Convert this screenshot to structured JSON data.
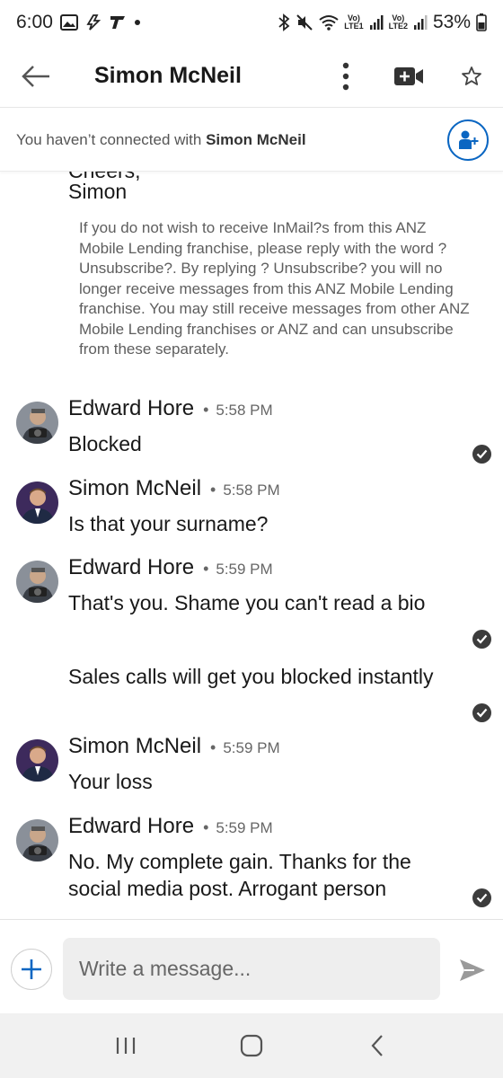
{
  "status_bar": {
    "time": "6:00",
    "lte1": "LTE1",
    "lte2": "LTE2",
    "volte": "Vo)",
    "battery": "53%"
  },
  "header": {
    "title": "Simon McNeil"
  },
  "banner": {
    "prefix": "You haven’t connected with ",
    "name": "Simon McNeil"
  },
  "conversation": {
    "cut_line": "Cheers,",
    "signoff": "Simon",
    "disclaimer": "If you do not wish to receive InMail?s from this ANZ Mobile Lending franchise, please reply with the word ?Unsubscribe?. By replying ? Unsubscribe? you will no longer receive messages from this ANZ Mobile Lending franchise. You may still receive messages from other ANZ Mobile Lending franchises or ANZ and can unsubscribe from these separately.",
    "groups": [
      {
        "sender": "Edward Hore",
        "time": "5:58 PM",
        "messages": [
          "Blocked"
        ]
      },
      {
        "sender": "Simon McNeil",
        "time": "5:58 PM",
        "messages": [
          "Is that your surname?"
        ]
      },
      {
        "sender": "Edward Hore",
        "time": "5:59 PM",
        "messages": [
          "That's you. Shame you can't read a bio",
          "Sales calls will get you blocked instantly"
        ]
      },
      {
        "sender": "Simon McNeil",
        "time": "5:59 PM",
        "messages": [
          "Your loss"
        ]
      },
      {
        "sender": "Edward Hore",
        "time": "5:59 PM",
        "messages": [
          "No. My complete gain. Thanks for the social media post. Arrogant person"
        ]
      }
    ]
  },
  "composer": {
    "placeholder": "Write a message..."
  },
  "colors": {
    "accent": "#0a66c2",
    "text": "#191919",
    "muted": "#666666"
  },
  "icons": [
    "back-arrow-icon",
    "more-vertical-icon",
    "video-call-icon",
    "star-icon",
    "add-connection-icon",
    "read-check-icon",
    "plus-icon",
    "send-icon",
    "recent-apps-icon",
    "home-icon",
    "back-icon"
  ]
}
